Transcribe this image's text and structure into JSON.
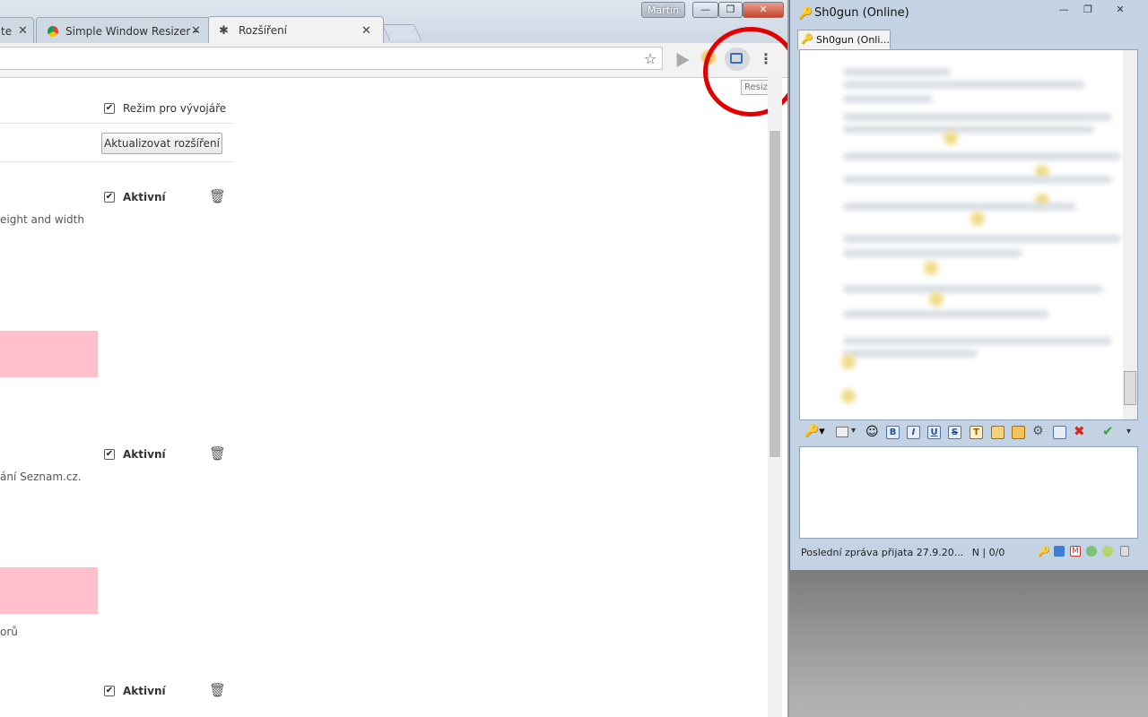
{
  "browser": {
    "profile_name": "Martin",
    "tabs": [
      {
        "label": "te",
        "close": "✕"
      },
      {
        "label": "Simple Window Resizer -",
        "close": "✕"
      },
      {
        "label": "Rozšíření",
        "close": "✕"
      }
    ],
    "window_controls": {
      "minimize": "—",
      "maximize": "❐",
      "close": "✕"
    },
    "toolbar": {
      "star_icon": "☆",
      "menu_icon": "⋮",
      "resize_tooltip": "Resize!"
    },
    "extensions_page": {
      "dev_mode_label": "Režim pro vývojáře",
      "update_button": "Aktualizovat rozšíření",
      "extensions": [
        {
          "active_label": "Aktivní",
          "description": "eight and width"
        },
        {
          "active_label": "Aktivní",
          "description": "ání Seznam.cz."
        },
        {
          "active_label": "Aktivní",
          "description": "orů"
        }
      ]
    }
  },
  "chat": {
    "window_title": "Sh0gun (Online)",
    "tab_label": "Sh0gun (Onli...",
    "window_controls": {
      "minimize": "—",
      "maximize": "❐",
      "close": "✕"
    },
    "format_buttons": [
      "B",
      "I",
      "U",
      "S",
      "T"
    ],
    "status_text": "Poslední zpráva přijata 27.9.20...",
    "status_counter": "N |  0/0",
    "accent_color": "#4a74b7"
  }
}
